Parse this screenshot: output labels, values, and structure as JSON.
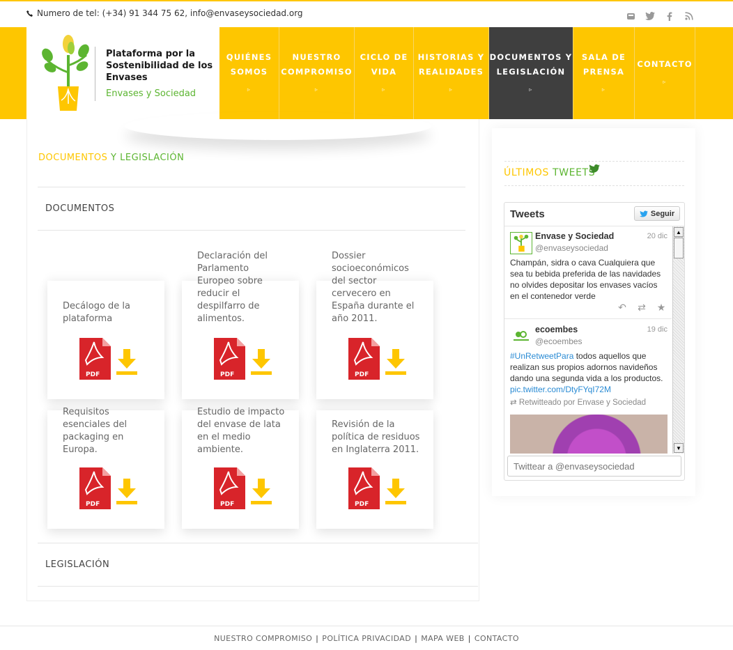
{
  "topbar": {
    "contact": "Numero de tel: (+34) 91 344 75 62, info@envaseysociedad.org",
    "social": [
      "youtube-icon",
      "twitter-icon",
      "facebook-icon",
      "rss-icon"
    ]
  },
  "logo": {
    "title": "Plataforma por la Sostenibilidad de los Envases",
    "subtitle": "Envases y Sociedad"
  },
  "nav": [
    {
      "label1": "QUIÉNES",
      "label2": "SOMOS"
    },
    {
      "label1": "NUESTRO",
      "label2": "COMPROMISO"
    },
    {
      "label1": "CICLO DE",
      "label2": "VIDA"
    },
    {
      "label1": "HISTORIAS Y",
      "label2": "REALIDADES"
    },
    {
      "label1": "DOCUMENTOS Y",
      "label2": "LEGISLACIÓN"
    },
    {
      "label1": "SALA DE",
      "label2": "PRENSA"
    },
    {
      "label1": "CONTACTO",
      "label2": ""
    }
  ],
  "page": {
    "title_part1": "DOCUMENTOS",
    "title_part2": " Y LEGISLACIÓN",
    "section_documents": "DOCUMENTOS",
    "section_legislation": "LEGISLACIÓN"
  },
  "documents": [
    {
      "label": "Decálogo de la plataforma"
    },
    {
      "label": "Declaración del Parlamento Europeo sobre reducir el despilfarro de alimentos."
    },
    {
      "label": "Dossier socioeconómicos del sector cervecero en España durante el año 2011."
    },
    {
      "label": "Requisitos esenciales del packaging en Europa."
    },
    {
      "label": "Estudio de impacto del envase de lata en el medio ambiente."
    },
    {
      "label": "Revisión de la política de residuos en Inglaterra 2011."
    }
  ],
  "pdf_badge": "PDF",
  "sidebar": {
    "title_part1": "ÚLTIMOS",
    "title_part2": " TWEETS",
    "widget_title": "Tweets",
    "follow_label": "Seguir",
    "input_placeholder": "Twittear a @envaseysociedad",
    "tweets": [
      {
        "name": "Envase y Sociedad",
        "handle": "@envaseysociedad",
        "date": "20 dic",
        "text": "Champán, sidra o cava Cualquiera que sea tu bebida preferida de las navidades no olvides depositar los envases vacíos en el contenedor verde"
      },
      {
        "name": "ecoembes",
        "handle": "@ecoembes",
        "date": "19 dic",
        "hashtag": "#UnRetweetPara",
        "text": " todos aquellos que realizan sus propios adornos navideños dando una segunda vida a los productos. ",
        "link": "pic.twitter.com/DtyFYqI72M",
        "retweet": "Retwitteado por Envase y Sociedad"
      }
    ]
  },
  "footer": [
    "NUESTRO COMPROMISO",
    "POLÍTICA PRIVACIDAD",
    "MAPA WEB",
    "CONTACTO"
  ],
  "colors": {
    "accent": "#fec600",
    "green": "#5cb531",
    "nav_active": "#3f3f3f",
    "pdf_red": "#d8242a"
  }
}
